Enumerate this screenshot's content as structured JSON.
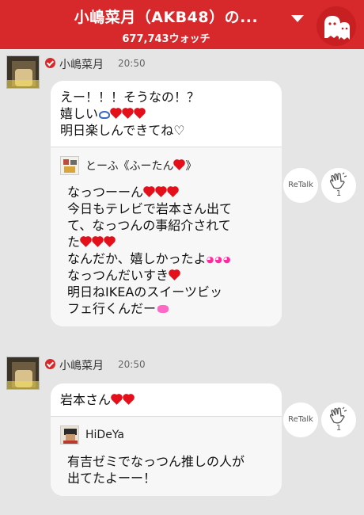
{
  "header": {
    "title": "小嶋菜月（AKB48）の...",
    "watch_count": "677,743ウォッチ"
  },
  "posts": [
    {
      "author": "小嶋菜月",
      "time": "20:50",
      "text_lines": [
        "えー！！！そうなの！？",
        "嬉しい",
        "明日楽しんできてね♡"
      ],
      "quote": {
        "author": "とーふ《ふーたん",
        "author_suffix": "》",
        "lines": [
          "なっつーーん",
          "今日もテレビで岩本さん出て",
          "て、なっつんの事紹介されて",
          "た",
          "なんだか、嬉しかったよ",
          "なっつんだいすき",
          "明日ねIKEAのスイーツビッ",
          "フェ行くんだー"
        ]
      },
      "retalk_label": "ReTalk",
      "clap_count": "1"
    },
    {
      "author": "小嶋菜月",
      "time": "20:50",
      "text_lines": [
        "岩本さん"
      ],
      "quote": {
        "author": "HiDeYa",
        "author_suffix": "",
        "lines": [
          "有吉ゼミでなっつん推しの人が",
          "出てたよーー！"
        ]
      },
      "retalk_label": "ReTalk",
      "clap_count": "1"
    }
  ],
  "colors": {
    "header_bg": "#d7282b",
    "heart": "#e3101b",
    "background": "#e5e5e5"
  },
  "icons": [
    "chevron-down-icon",
    "ghost-avatar-icon",
    "verified-check-icon",
    "clap-icon"
  ]
}
